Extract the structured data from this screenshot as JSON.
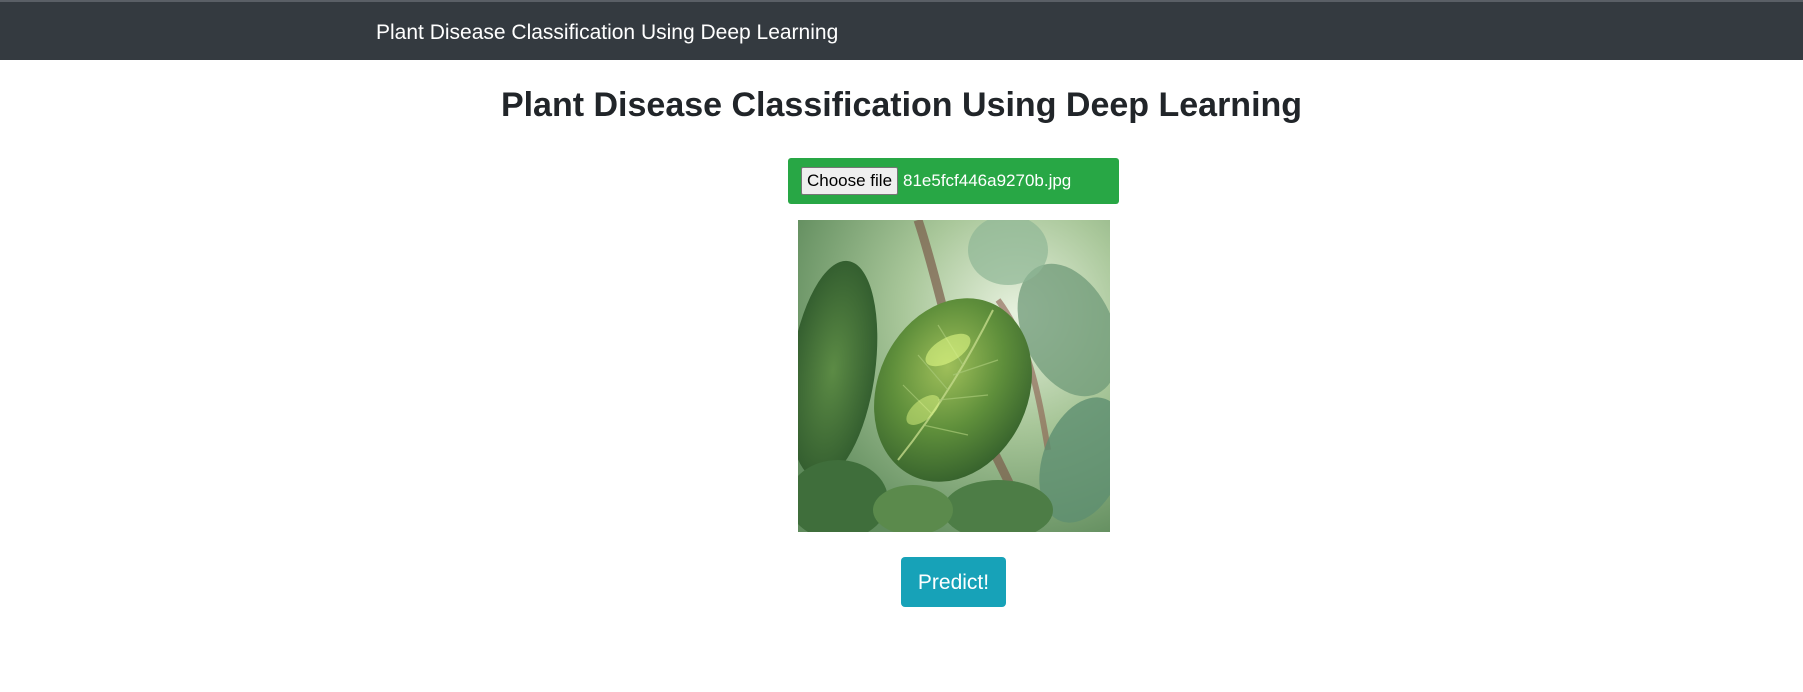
{
  "navbar": {
    "brand": "Plant Disease Classification Using Deep Learning"
  },
  "main": {
    "title": "Plant Disease Classification Using Deep Learning",
    "upload": {
      "button_label": "Choose file",
      "file_name": "81e5fcf446a9270b.jpg"
    },
    "predict_label": "Predict!"
  },
  "colors": {
    "navbar": "#343a40",
    "upload_box": "#28a745",
    "predict_button": "#17a2b8",
    "title_text": "#212529"
  }
}
